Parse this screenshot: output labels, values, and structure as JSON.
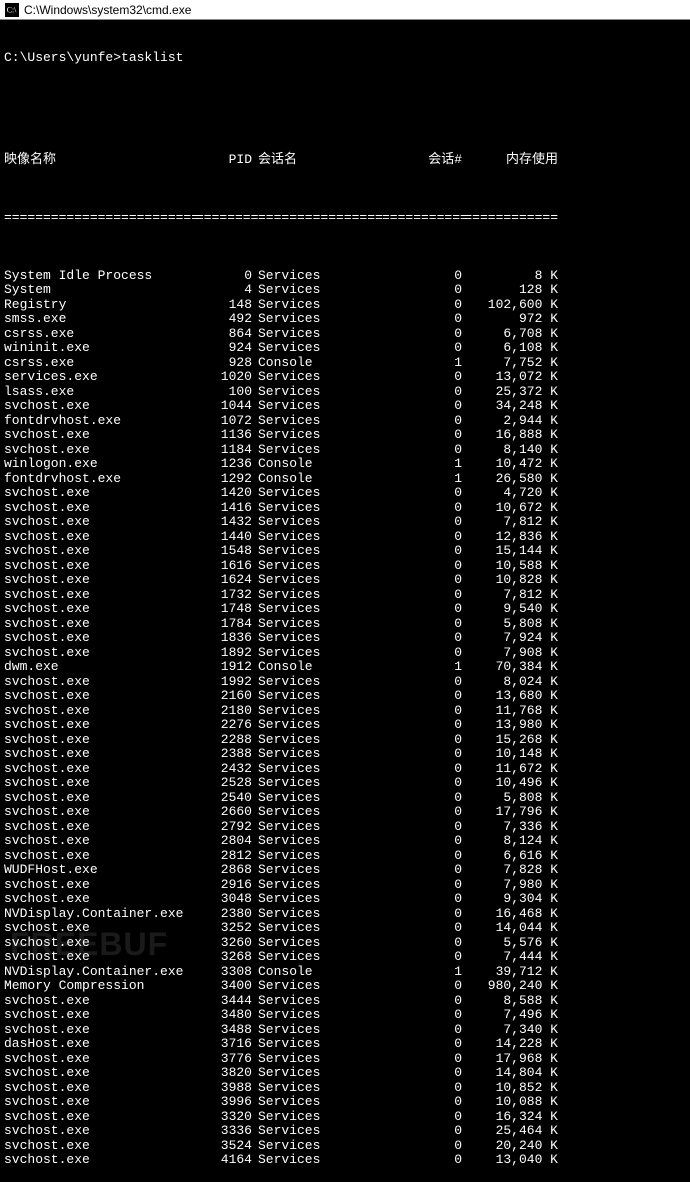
{
  "window": {
    "title": "C:\\Windows\\system32\\cmd.exe"
  },
  "prompt": "C:\\Users\\yunfe>tasklist",
  "headers": {
    "name": "映像名称",
    "pid": "PID",
    "session_name": "会话名",
    "session_num": "会话#",
    "mem": "内存使用"
  },
  "separators": {
    "name": "=========================",
    "pid": "========",
    "session_name": "================",
    "session_num": "===========",
    "mem": "============"
  },
  "processes": [
    {
      "name": "System Idle Process",
      "pid": "0",
      "sess": "Services",
      "sn": "0",
      "mem": "8 K"
    },
    {
      "name": "System",
      "pid": "4",
      "sess": "Services",
      "sn": "0",
      "mem": "128 K"
    },
    {
      "name": "Registry",
      "pid": "148",
      "sess": "Services",
      "sn": "0",
      "mem": "102,600 K"
    },
    {
      "name": "smss.exe",
      "pid": "492",
      "sess": "Services",
      "sn": "0",
      "mem": "972 K"
    },
    {
      "name": "csrss.exe",
      "pid": "864",
      "sess": "Services",
      "sn": "0",
      "mem": "6,708 K"
    },
    {
      "name": "wininit.exe",
      "pid": "924",
      "sess": "Services",
      "sn": "0",
      "mem": "6,108 K"
    },
    {
      "name": "csrss.exe",
      "pid": "928",
      "sess": "Console",
      "sn": "1",
      "mem": "7,752 K"
    },
    {
      "name": "services.exe",
      "pid": "1020",
      "sess": "Services",
      "sn": "0",
      "mem": "13,072 K"
    },
    {
      "name": "lsass.exe",
      "pid": "100",
      "sess": "Services",
      "sn": "0",
      "mem": "25,372 K"
    },
    {
      "name": "svchost.exe",
      "pid": "1044",
      "sess": "Services",
      "sn": "0",
      "mem": "34,248 K"
    },
    {
      "name": "fontdrvhost.exe",
      "pid": "1072",
      "sess": "Services",
      "sn": "0",
      "mem": "2,944 K"
    },
    {
      "name": "svchost.exe",
      "pid": "1136",
      "sess": "Services",
      "sn": "0",
      "mem": "16,888 K"
    },
    {
      "name": "svchost.exe",
      "pid": "1184",
      "sess": "Services",
      "sn": "0",
      "mem": "8,140 K"
    },
    {
      "name": "winlogon.exe",
      "pid": "1236",
      "sess": "Console",
      "sn": "1",
      "mem": "10,472 K"
    },
    {
      "name": "fontdrvhost.exe",
      "pid": "1292",
      "sess": "Console",
      "sn": "1",
      "mem": "26,580 K"
    },
    {
      "name": "svchost.exe",
      "pid": "1420",
      "sess": "Services",
      "sn": "0",
      "mem": "4,720 K"
    },
    {
      "name": "svchost.exe",
      "pid": "1416",
      "sess": "Services",
      "sn": "0",
      "mem": "10,672 K"
    },
    {
      "name": "svchost.exe",
      "pid": "1432",
      "sess": "Services",
      "sn": "0",
      "mem": "7,812 K"
    },
    {
      "name": "svchost.exe",
      "pid": "1440",
      "sess": "Services",
      "sn": "0",
      "mem": "12,836 K"
    },
    {
      "name": "svchost.exe",
      "pid": "1548",
      "sess": "Services",
      "sn": "0",
      "mem": "15,144 K"
    },
    {
      "name": "svchost.exe",
      "pid": "1616",
      "sess": "Services",
      "sn": "0",
      "mem": "10,588 K"
    },
    {
      "name": "svchost.exe",
      "pid": "1624",
      "sess": "Services",
      "sn": "0",
      "mem": "10,828 K"
    },
    {
      "name": "svchost.exe",
      "pid": "1732",
      "sess": "Services",
      "sn": "0",
      "mem": "7,812 K"
    },
    {
      "name": "svchost.exe",
      "pid": "1748",
      "sess": "Services",
      "sn": "0",
      "mem": "9,540 K"
    },
    {
      "name": "svchost.exe",
      "pid": "1784",
      "sess": "Services",
      "sn": "0",
      "mem": "5,808 K"
    },
    {
      "name": "svchost.exe",
      "pid": "1836",
      "sess": "Services",
      "sn": "0",
      "mem": "7,924 K"
    },
    {
      "name": "svchost.exe",
      "pid": "1892",
      "sess": "Services",
      "sn": "0",
      "mem": "7,908 K"
    },
    {
      "name": "dwm.exe",
      "pid": "1912",
      "sess": "Console",
      "sn": "1",
      "mem": "70,384 K"
    },
    {
      "name": "svchost.exe",
      "pid": "1992",
      "sess": "Services",
      "sn": "0",
      "mem": "8,024 K"
    },
    {
      "name": "svchost.exe",
      "pid": "2160",
      "sess": "Services",
      "sn": "0",
      "mem": "13,680 K"
    },
    {
      "name": "svchost.exe",
      "pid": "2180",
      "sess": "Services",
      "sn": "0",
      "mem": "11,768 K"
    },
    {
      "name": "svchost.exe",
      "pid": "2276",
      "sess": "Services",
      "sn": "0",
      "mem": "13,980 K"
    },
    {
      "name": "svchost.exe",
      "pid": "2288",
      "sess": "Services",
      "sn": "0",
      "mem": "15,268 K"
    },
    {
      "name": "svchost.exe",
      "pid": "2388",
      "sess": "Services",
      "sn": "0",
      "mem": "10,148 K"
    },
    {
      "name": "svchost.exe",
      "pid": "2432",
      "sess": "Services",
      "sn": "0",
      "mem": "11,672 K"
    },
    {
      "name": "svchost.exe",
      "pid": "2528",
      "sess": "Services",
      "sn": "0",
      "mem": "10,496 K"
    },
    {
      "name": "svchost.exe",
      "pid": "2540",
      "sess": "Services",
      "sn": "0",
      "mem": "5,808 K"
    },
    {
      "name": "svchost.exe",
      "pid": "2660",
      "sess": "Services",
      "sn": "0",
      "mem": "17,796 K"
    },
    {
      "name": "svchost.exe",
      "pid": "2792",
      "sess": "Services",
      "sn": "0",
      "mem": "7,336 K"
    },
    {
      "name": "svchost.exe",
      "pid": "2804",
      "sess": "Services",
      "sn": "0",
      "mem": "8,124 K"
    },
    {
      "name": "svchost.exe",
      "pid": "2812",
      "sess": "Services",
      "sn": "0",
      "mem": "6,616 K"
    },
    {
      "name": "WUDFHost.exe",
      "pid": "2868",
      "sess": "Services",
      "sn": "0",
      "mem": "7,828 K"
    },
    {
      "name": "svchost.exe",
      "pid": "2916",
      "sess": "Services",
      "sn": "0",
      "mem": "7,980 K"
    },
    {
      "name": "svchost.exe",
      "pid": "3048",
      "sess": "Services",
      "sn": "0",
      "mem": "9,304 K"
    },
    {
      "name": "NVDisplay.Container.exe",
      "pid": "2380",
      "sess": "Services",
      "sn": "0",
      "mem": "16,468 K"
    },
    {
      "name": "svchost.exe",
      "pid": "3252",
      "sess": "Services",
      "sn": "0",
      "mem": "14,044 K"
    },
    {
      "name": "svchost.exe",
      "pid": "3260",
      "sess": "Services",
      "sn": "0",
      "mem": "5,576 K"
    },
    {
      "name": "svchost.exe",
      "pid": "3268",
      "sess": "Services",
      "sn": "0",
      "mem": "7,444 K"
    },
    {
      "name": "NVDisplay.Container.exe",
      "pid": "3308",
      "sess": "Console",
      "sn": "1",
      "mem": "39,712 K"
    },
    {
      "name": "Memory Compression",
      "pid": "3400",
      "sess": "Services",
      "sn": "0",
      "mem": "980,240 K"
    },
    {
      "name": "svchost.exe",
      "pid": "3444",
      "sess": "Services",
      "sn": "0",
      "mem": "8,588 K"
    },
    {
      "name": "svchost.exe",
      "pid": "3480",
      "sess": "Services",
      "sn": "0",
      "mem": "7,496 K"
    },
    {
      "name": "svchost.exe",
      "pid": "3488",
      "sess": "Services",
      "sn": "0",
      "mem": "7,340 K"
    },
    {
      "name": "dasHost.exe",
      "pid": "3716",
      "sess": "Services",
      "sn": "0",
      "mem": "14,228 K"
    },
    {
      "name": "svchost.exe",
      "pid": "3776",
      "sess": "Services",
      "sn": "0",
      "mem": "17,968 K"
    },
    {
      "name": "svchost.exe",
      "pid": "3820",
      "sess": "Services",
      "sn": "0",
      "mem": "14,804 K"
    },
    {
      "name": "svchost.exe",
      "pid": "3988",
      "sess": "Services",
      "sn": "0",
      "mem": "10,852 K"
    },
    {
      "name": "svchost.exe",
      "pid": "3996",
      "sess": "Services",
      "sn": "0",
      "mem": "10,088 K"
    },
    {
      "name": "svchost.exe",
      "pid": "3320",
      "sess": "Services",
      "sn": "0",
      "mem": "16,324 K"
    },
    {
      "name": "svchost.exe",
      "pid": "3336",
      "sess": "Services",
      "sn": "0",
      "mem": "25,464 K"
    },
    {
      "name": "svchost.exe",
      "pid": "3524",
      "sess": "Services",
      "sn": "0",
      "mem": "20,240 K"
    },
    {
      "name": "svchost.exe",
      "pid": "4164",
      "sess": "Services",
      "sn": "0",
      "mem": "13,040 K"
    }
  ],
  "watermark": "FREEBUF"
}
